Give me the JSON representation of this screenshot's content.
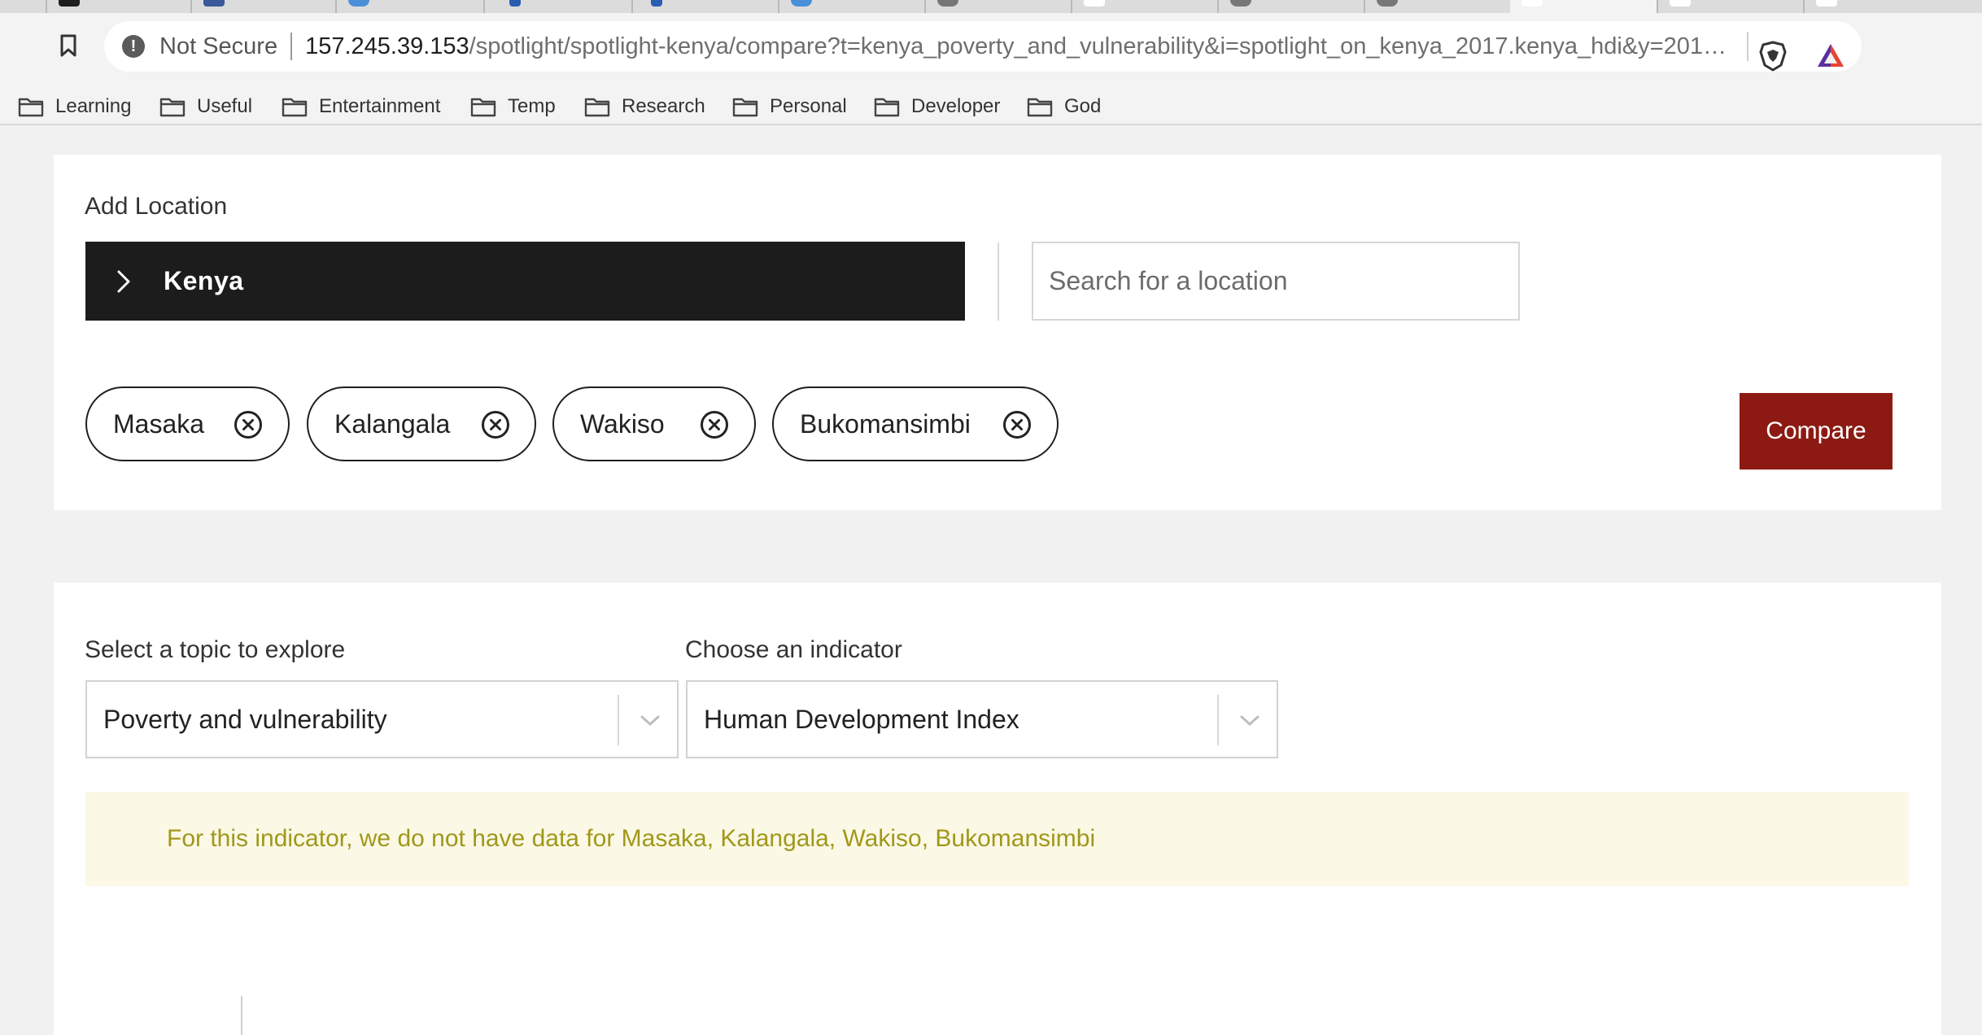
{
  "browser": {
    "security_label": "Not Secure",
    "url_host": "157.245.39.153",
    "url_path": "/spotlight/spotlight-kenya/compare?t=kenya_poverty_and_vulnerability&i=spotlight_on_kenya_2017.kenya_hdi&y=2014&lc=...",
    "bookmarks": [
      "Learning",
      "Useful",
      "Entertainment",
      "Temp",
      "Research",
      "Personal",
      "Developer",
      "God"
    ]
  },
  "location": {
    "heading": "Add Location",
    "selected_country": "Kenya",
    "search_placeholder": "Search for a location",
    "chips": [
      "Masaka",
      "Kalangala",
      "Wakiso",
      "Bukomansimbi"
    ],
    "compare_label": "Compare"
  },
  "topic": {
    "topic_label": "Select a topic to explore",
    "topic_value": "Poverty and vulnerability",
    "indicator_label": "Choose an indicator",
    "indicator_value": "Human Development Index",
    "notice": "For this indicator, we do not have data for Masaka, Kalangala, Wakiso, Bukomansimbi"
  },
  "colors": {
    "compare_button": "#8c1a13",
    "country_bar": "#1c1c1c",
    "notice_background": "#fbf8e6",
    "notice_text": "#a0981a"
  }
}
